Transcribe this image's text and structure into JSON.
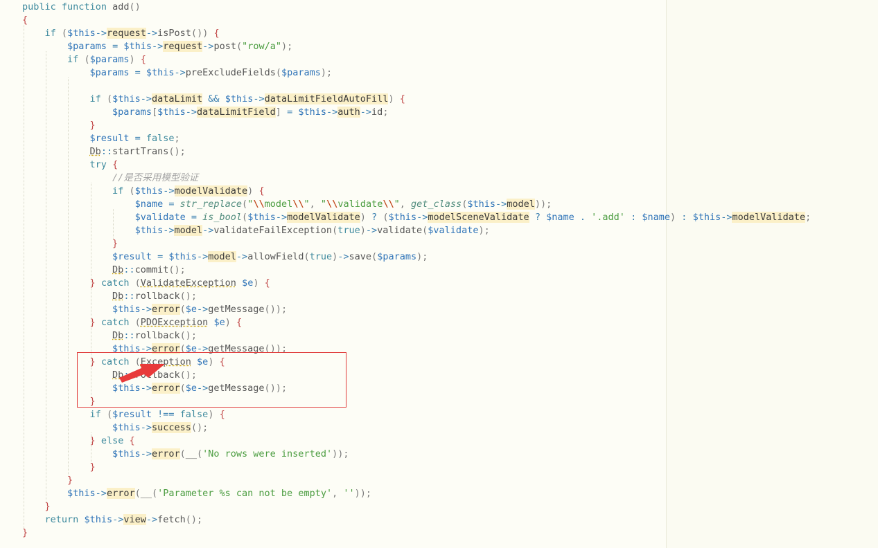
{
  "editor": {
    "lines": [
      "public function add()",
      "{",
      "    if ($this->request->isPost()) {",
      "        $params = $this->request->post(\"row/a\");",
      "        if ($params) {",
      "            $params = $this->preExcludeFields($params);",
      "",
      "            if ($this->dataLimit && $this->dataLimitFieldAutoFill) {",
      "                $params[$this->dataLimitField] = $this->auth->id;",
      "            }",
      "            $result = false;",
      "            Db::startTrans();",
      "            try {",
      "                //是否采用模型验证",
      "                if ($this->modelValidate) {",
      "                    $name = str_replace(\"\\\\model\\\\\", \"\\\\validate\\\\\", get_class($this->model));",
      "                    $validate = is_bool($this->modelValidate) ? ($this->modelSceneValidate ? $name . '.add' : $name) : $this->modelValidate;",
      "                    $this->model->validateFailException(true)->validate($validate);",
      "                }",
      "                $result = $this->model->allowField(true)->save($params);",
      "                Db::commit();",
      "            } catch (ValidateException $e) {",
      "                Db::rollback();",
      "                $this->error($e->getMessage());",
      "            } catch (PDOException $e) {",
      "                Db::rollback();",
      "                $this->error($e->getMessage());",
      "            } catch (Exception $e) {",
      "                Db::rollback();",
      "                $this->error($e->getMessage());",
      "            }",
      "            if ($result !== false) {",
      "                $this->success();",
      "            } else {",
      "                $this->error(__('No rows were inserted'));",
      "            }",
      "        }",
      "        $this->error(__('Parameter %s can not be empty', ''));",
      "    }",
      "    return $this->view->fetch();",
      "}"
    ]
  },
  "annotation": {
    "highlight_color": "#e03a3a",
    "arrow_color": "#e83a3a"
  }
}
